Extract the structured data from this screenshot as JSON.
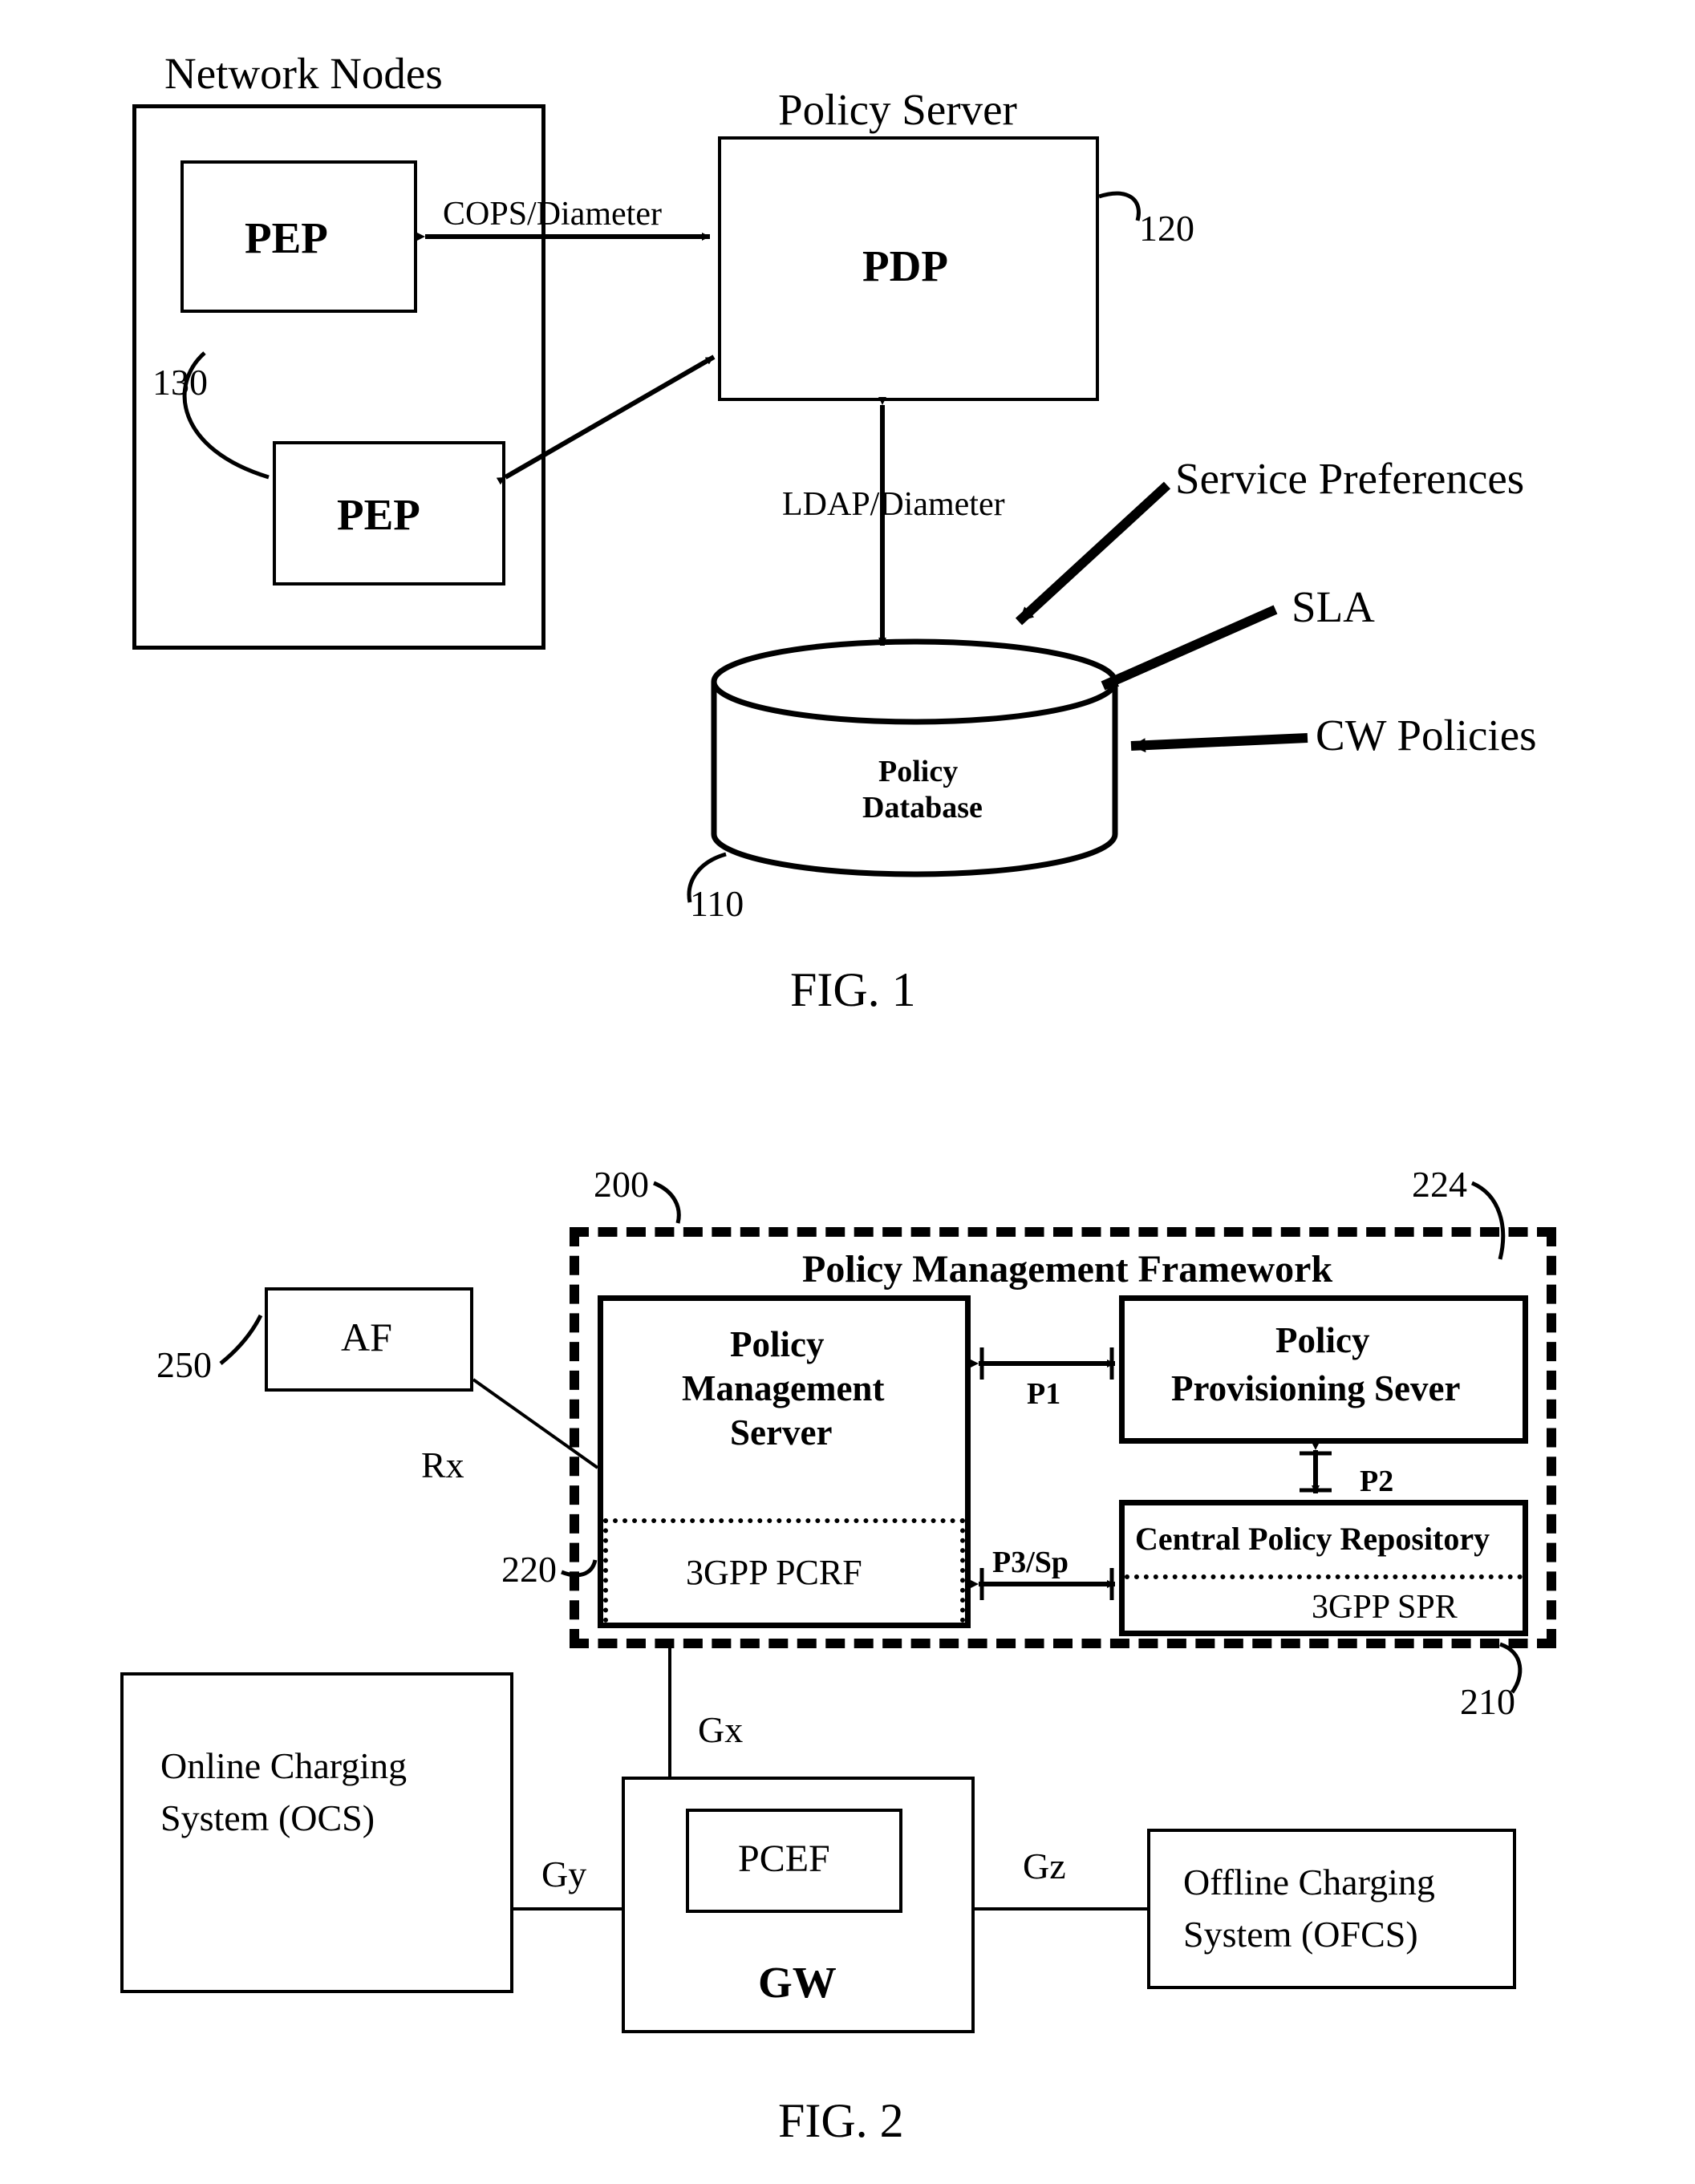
{
  "fig1": {
    "title": "FIG. 1",
    "network_nodes_label": "Network Nodes",
    "policy_server_label": "Policy Server",
    "pdp_label": "PDP",
    "pep1_label": "PEP",
    "pep2_label": "PEP",
    "cops_label": "COPS/Diameter",
    "ldap_label": "LDAP/Diameter",
    "policy_db_label1": "Policy",
    "policy_db_label2": "Database",
    "sp_label": "Service Preferences",
    "sla_label": "SLA",
    "cw_label": "CW Policies",
    "ref130": "130",
    "ref120": "120",
    "ref110": "110"
  },
  "fig2": {
    "title": "FIG. 2",
    "pmf_label": "Policy Management Framework",
    "pms_label1": "Policy",
    "pms_label2": "Management",
    "pms_label3": "Server",
    "pms_sub": "3GPP PCRF",
    "pps_label1": "Policy",
    "pps_label2": "Provisioning Sever",
    "cpr_label": "Central Policy Repository",
    "cpr_sub": "3GPP SPR",
    "p1": "P1",
    "p2": "P2",
    "p3": "P3/Sp",
    "af_label": "AF",
    "rx_label": "Rx",
    "gx_label": "Gx",
    "gy_label": "Gy",
    "gz_label": "Gz",
    "ocs_label1": "Online Charging",
    "ocs_label2": "System (OCS)",
    "ofcs_label1": "Offline Charging",
    "ofcs_label2": "System (OFCS)",
    "pcef_label": "PCEF",
    "gw_label": "GW",
    "ref200": "200",
    "ref224": "224",
    "ref250": "250",
    "ref220": "220",
    "ref210": "210"
  },
  "chart_data": {
    "type": "table",
    "figures": [
      {
        "id": "FIG. 1",
        "description": "Policy architecture block diagram",
        "nodes": [
          {
            "id": "130",
            "name": "Network Nodes container",
            "contains": [
              "PEP (x2)"
            ]
          },
          {
            "id": "120",
            "name": "Policy Server",
            "contains": [
              "PDP"
            ]
          },
          {
            "id": "110",
            "name": "Policy Database"
          }
        ],
        "edges": [
          {
            "from": "PEP",
            "to": "PDP",
            "label": "COPS/Diameter",
            "bidirectional": true
          },
          {
            "from": "PEP (lower)",
            "to": "PDP",
            "bidirectional": true
          },
          {
            "from": "PDP",
            "to": "Policy Database",
            "label": "LDAP/Diameter",
            "bidirectional": true
          },
          {
            "from": "Service Preferences",
            "to": "Policy Database",
            "pointer": true
          },
          {
            "from": "SLA",
            "to": "Policy Database",
            "pointer": true
          },
          {
            "from": "CW Policies",
            "to": "Policy Database",
            "pointer": true
          }
        ]
      },
      {
        "id": "FIG. 2",
        "description": "Policy Management Framework in 3GPP PCC context",
        "nodes": [
          {
            "id": "200",
            "name": "Policy Management Framework",
            "contains": [
              "Policy Management Server (220)",
              "Policy Provisioning Sever (224)",
              "Central Policy Repository (210)"
            ]
          },
          {
            "id": "220",
            "name": "Policy Management Server",
            "sub": "3GPP PCRF"
          },
          {
            "id": "224",
            "name": "Policy Provisioning Sever"
          },
          {
            "id": "210",
            "name": "Central Policy Repository",
            "sub": "3GPP SPR"
          },
          {
            "id": "250",
            "name": "AF"
          },
          {
            "name": "Online Charging System (OCS)"
          },
          {
            "name": "Offline Charging System (OFCS)"
          },
          {
            "name": "GW",
            "contains": [
              "PCEF"
            ]
          }
        ],
        "edges": [
          {
            "from": "AF",
            "to": "Policy Management Server",
            "label": "Rx"
          },
          {
            "from": "Policy Management Server",
            "to": "Policy Provisioning Sever",
            "label": "P1",
            "bidirectional": true
          },
          {
            "from": "Policy Provisioning Sever",
            "to": "Central Policy Repository",
            "label": "P2",
            "bidirectional": true
          },
          {
            "from": "Policy Management Server",
            "to": "Central Policy Repository",
            "label": "P3/Sp",
            "bidirectional": true
          },
          {
            "from": "Policy Management Server",
            "to": "GW/PCEF",
            "label": "Gx"
          },
          {
            "from": "OCS",
            "to": "GW",
            "label": "Gy"
          },
          {
            "from": "GW",
            "to": "OFCS",
            "label": "Gz"
          }
        ]
      }
    ]
  }
}
